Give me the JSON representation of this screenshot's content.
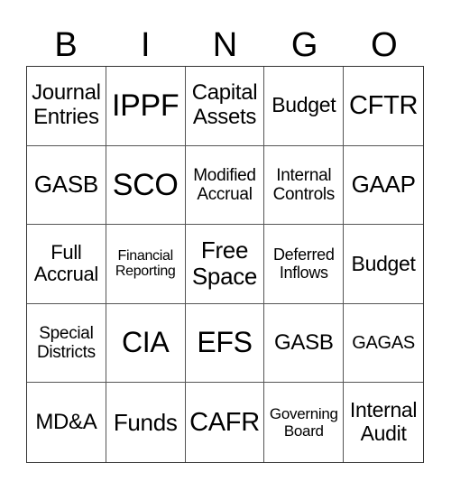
{
  "header": {
    "letters": [
      "B",
      "I",
      "N",
      "G",
      "O"
    ]
  },
  "grid": {
    "rows": [
      [
        "Journal\nEntries",
        "IPPF",
        "Capital\nAssets",
        "Budget",
        "CFTR"
      ],
      [
        "GASB",
        "SCO",
        "Modified\nAccrual",
        "Internal\nControls",
        "GAAP"
      ],
      [
        "Full\nAccrual",
        "Financial\nReporting",
        "Free\nSpace",
        "Deferred\nInflows",
        "Budget"
      ],
      [
        "Special\nDistricts",
        "CIA",
        "EFS",
        "GASB",
        "GAGAS"
      ],
      [
        "MD&A",
        "Funds",
        "CAFR",
        "Governing\nBoard",
        "Internal\nAudit"
      ]
    ]
  }
}
